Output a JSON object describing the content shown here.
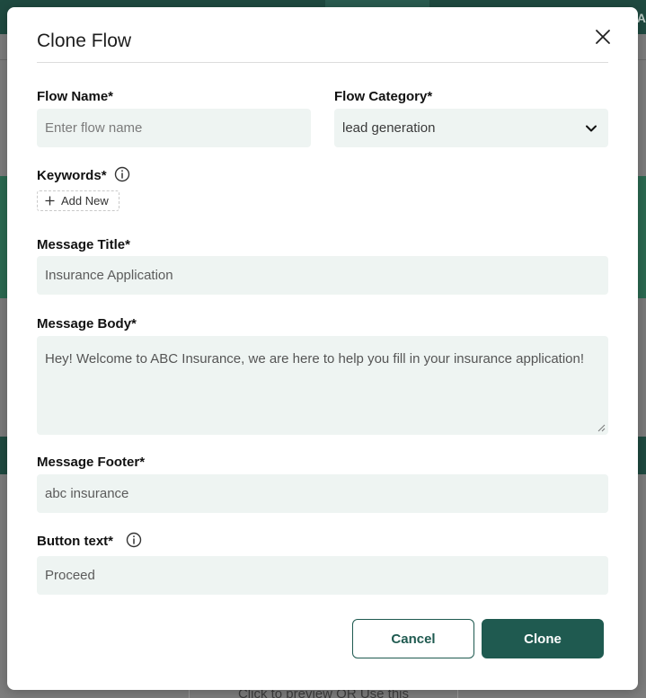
{
  "background": {
    "topbar_edge_text": "NA",
    "preview_text": "Click to preview OR  Use this"
  },
  "modal": {
    "title": "Clone Flow",
    "close_icon": "close-icon",
    "flow_name": {
      "label": "Flow Name*",
      "placeholder": "Enter flow name",
      "value": ""
    },
    "flow_category": {
      "label": "Flow Category*",
      "selected": "lead generation"
    },
    "keywords": {
      "label": "Keywords*",
      "add_new_label": "Add New"
    },
    "message_title": {
      "label": "Message Title*",
      "value": "Insurance Application"
    },
    "message_body": {
      "label": "Message Body*",
      "value": "Hey! Welcome to  ABC Insurance, we are here to help you fill in your insurance application!"
    },
    "message_footer": {
      "label": "Message Footer*",
      "value": "abc insurance"
    },
    "button_text": {
      "label": "Button text*",
      "value": "Proceed"
    },
    "actions": {
      "cancel_label": "Cancel",
      "clone_label": "Clone"
    }
  },
  "colors": {
    "primary": "#1f5a50",
    "field_bg": "#eef4f2",
    "overlay_bg": "#7d7d7d"
  }
}
